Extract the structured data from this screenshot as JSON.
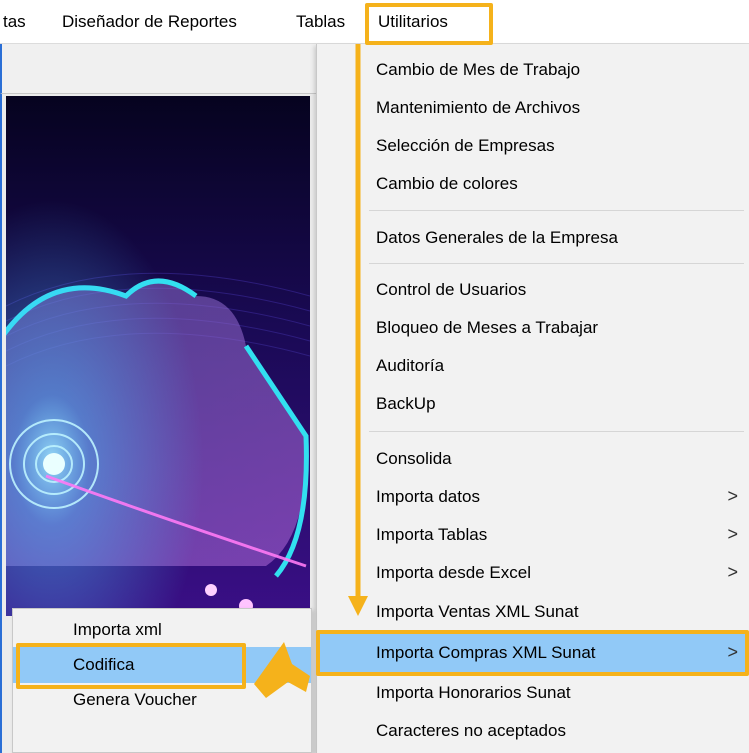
{
  "menubar": {
    "items": [
      {
        "label": "tas"
      },
      {
        "label": "Diseñador de Reportes"
      },
      {
        "label": "Tablas"
      },
      {
        "label": "Utilitarios"
      }
    ]
  },
  "dropdown": {
    "items": [
      {
        "label": "Cambio de Mes de Trabajo"
      },
      {
        "label": "Mantenimiento de Archivos"
      },
      {
        "label": "Selección de Empresas"
      },
      {
        "label": "Cambio de colores"
      },
      {
        "label": "Datos Generales de la Empresa"
      },
      {
        "label": "Control de Usuarios"
      },
      {
        "label": "Bloqueo de Meses a Trabajar"
      },
      {
        "label": "Auditoría"
      },
      {
        "label": "BackUp"
      },
      {
        "label": "Consolida"
      },
      {
        "label": "Importa datos",
        "chevron": ">"
      },
      {
        "label": "Importa Tablas",
        "chevron": ">"
      },
      {
        "label": "Importa desde Excel",
        "chevron": ">"
      },
      {
        "label": "Importa Ventas XML Sunat"
      },
      {
        "label": "Importa Compras XML Sunat",
        "chevron": ">"
      },
      {
        "label": "Importa Honorarios Sunat"
      },
      {
        "label": "Caracteres no aceptados"
      }
    ],
    "highlight_color": "#91c9f7"
  },
  "submenu": {
    "items": [
      {
        "label": "Importa xml"
      },
      {
        "label": "Codifica"
      },
      {
        "label": "Genera Voucher"
      }
    ]
  },
  "colors": {
    "annotation": "#f5b21b",
    "menu_background": "#f2f2f2",
    "highlight": "#91c9f7",
    "window_accent": "#2b6fd6"
  }
}
